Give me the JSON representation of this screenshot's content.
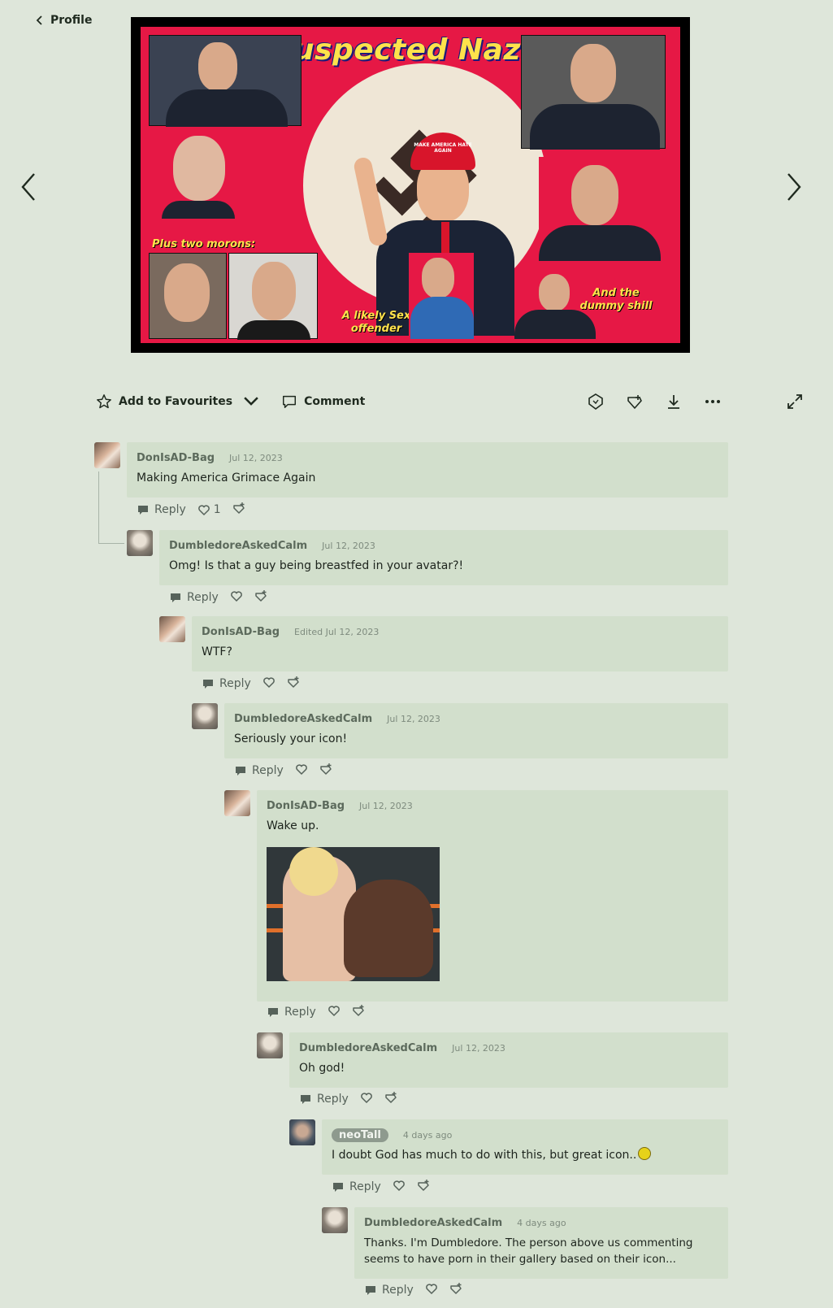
{
  "header": {
    "back_label": "Profile"
  },
  "artwork": {
    "title": "Suspected Nazis",
    "caption_left": "Plus two morons:",
    "caption_bottom": "A likely Sex offender",
    "caption_right": "And the dummy shill",
    "hat_text": "MAKE AMERICA HATE AGAIN"
  },
  "actions": {
    "favourite_label": "Add to Favourites",
    "comment_label": "Comment"
  },
  "icons": {
    "back": "chevron-left-icon",
    "prev": "chevron-left-icon",
    "next": "chevron-right-icon",
    "favourite": "star-icon",
    "dropdown": "chevron-down-icon",
    "comment": "speech-bubble-icon",
    "badge": "badge-icon",
    "gift": "gift-icon",
    "download": "download-icon",
    "more": "more-icon",
    "expand": "expand-icon",
    "reply": "reply-icon",
    "like": "heart-icon",
    "award": "award-icon"
  },
  "comments": [
    {
      "user": "DonIsAD-Bag",
      "date": "Jul 12, 2023",
      "text": "Making America Grimace Again",
      "likes": "1",
      "reply": "Reply"
    },
    {
      "user": "DumbledoreAskedCalm",
      "date": "Jul 12, 2023",
      "text": "Omg! Is that a guy being breastfed in your avatar?!",
      "reply": "Reply"
    },
    {
      "user": "DonIsAD-Bag",
      "date": "Edited Jul 12, 2023",
      "text": "WTF?",
      "reply": "Reply"
    },
    {
      "user": "DumbledoreAskedCalm",
      "date": "Jul 12, 2023",
      "text": "Seriously your icon!",
      "reply": "Reply"
    },
    {
      "user": "DonIsAD-Bag",
      "date": "Jul 12, 2023",
      "text": "Wake up.",
      "reply": "Reply"
    },
    {
      "user": "DumbledoreAskedCalm",
      "date": "Jul 12, 2023",
      "text": "Oh god!",
      "reply": "Reply"
    },
    {
      "user": "neoTall",
      "date": "4 days ago",
      "text": "I doubt God has much to do with this, but great icon..",
      "reply": "Reply"
    },
    {
      "user": "DumbledoreAskedCalm",
      "date": "4 days ago",
      "text": "Thanks. I'm Dumbledore. The person above us commenting seems to have porn in their gallery based on their icon...",
      "reply": "Reply"
    }
  ]
}
